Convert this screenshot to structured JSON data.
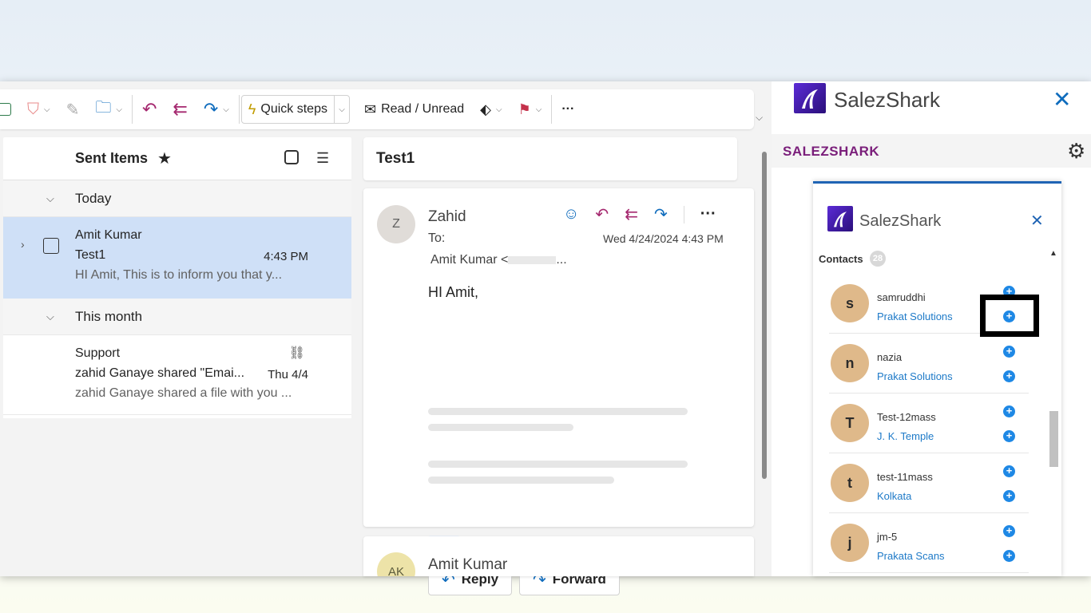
{
  "toolbar": {
    "quick_steps": "Quick steps",
    "read_unread": "Read / Unread",
    "more": "···"
  },
  "list": {
    "folder": "Sent Items",
    "groups": [
      {
        "label": "Today"
      },
      {
        "label": "This month"
      }
    ],
    "items": [
      {
        "from": "Amit Kumar",
        "subject": "Test1",
        "time": "4:43 PM",
        "preview": "HI Amit, This is to inform you that y..."
      },
      {
        "from": "Support",
        "subject": "zahid Ganaye shared \"Emai...",
        "time": "Thu 4/4",
        "preview": "zahid Ganaye shared a file with you ..."
      }
    ]
  },
  "reading": {
    "subject": "Test1",
    "sender": "Zahid",
    "avatar": "Z",
    "to_label": "To:",
    "date": "Wed 4/24/2024 4:43 PM",
    "recipient": "Amit Kumar <",
    "recipient_tail": "...",
    "greeting": "HI Amit,",
    "dots": "···",
    "reply": "Reply",
    "forward": "Forward",
    "second_sender": "Amit Kumar",
    "second_avatar": "AK"
  },
  "panel": {
    "title": "SalezShark",
    "brand": "SALEZSHARK",
    "inner_title": "SalezShark",
    "contacts_label": "Contacts",
    "contacts_count": "28",
    "contacts": [
      {
        "initial": "s",
        "name": "samruddhi",
        "company": "Prakat Solutions"
      },
      {
        "initial": "n",
        "name": "nazia",
        "company": "Prakat Solutions"
      },
      {
        "initial": "T",
        "name": "Test-12mass",
        "company": "J. K. Temple"
      },
      {
        "initial": "t",
        "name": "test-11mass",
        "company": "Kolkata"
      },
      {
        "initial": "j",
        "name": "jm-5",
        "company": "Prakata Scans"
      }
    ],
    "accent": "#1e88e5"
  }
}
